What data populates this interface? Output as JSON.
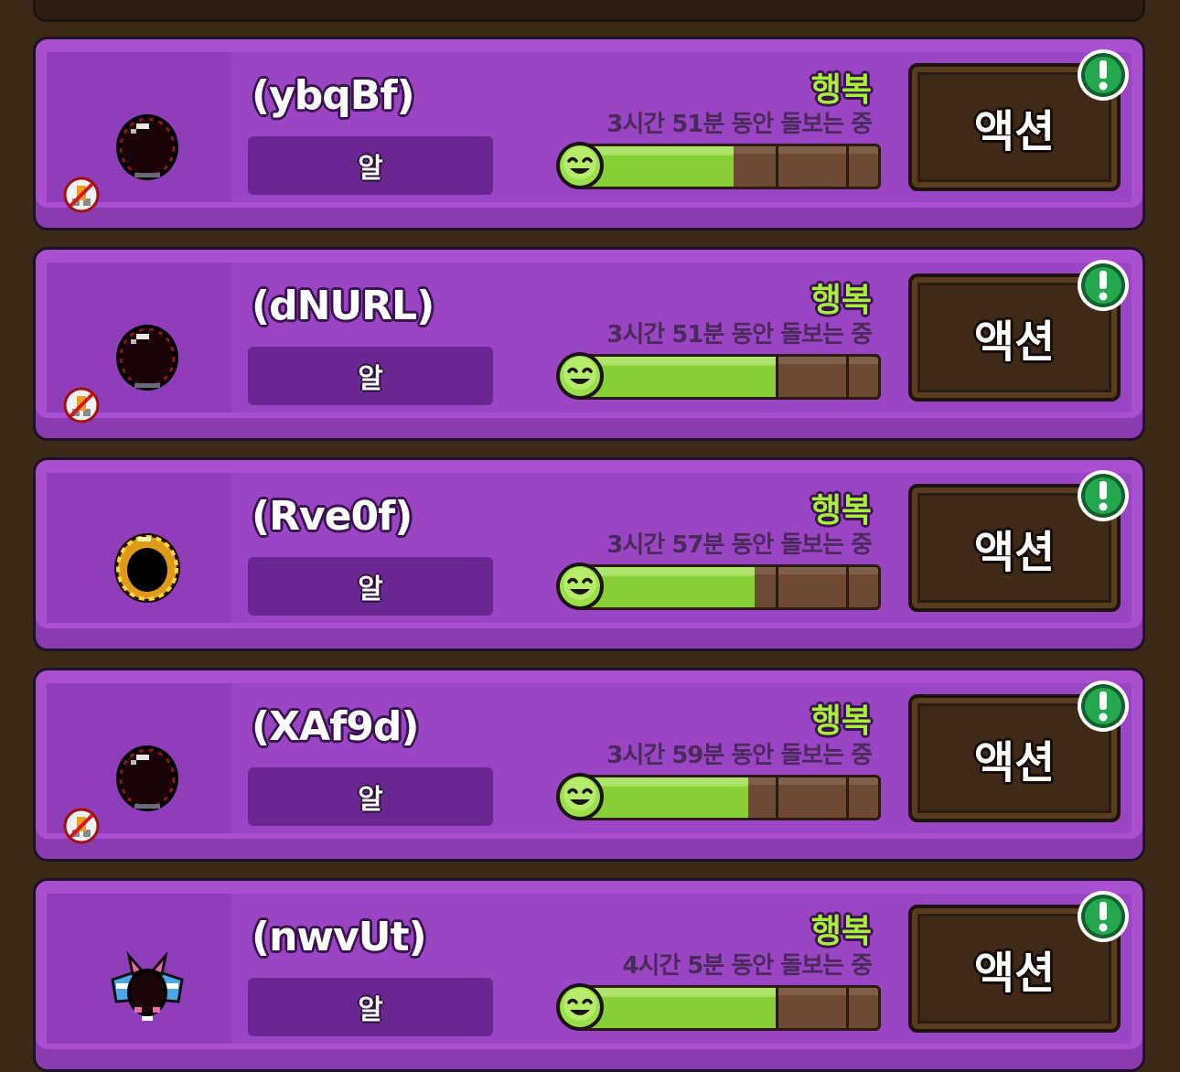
{
  "pets": [
    {
      "name": "(ybqBf)",
      "type": "알",
      "mood": "행복",
      "care_time": "3시간 51분 동안 돌보는 중",
      "happiness": 0.52,
      "sprite": "dark-egg",
      "badge": true
    },
    {
      "name": "(dNURL)",
      "type": "알",
      "mood": "행복",
      "care_time": "3시간 51분 동안 돌보는 중",
      "happiness": 0.67,
      "sprite": "dark-egg",
      "badge": true
    },
    {
      "name": "(Rve0f)",
      "type": "알",
      "mood": "행복",
      "care_time": "3시간 57분 동안 돌보는 중",
      "happiness": 0.59,
      "sprite": "gold-egg",
      "badge": false
    },
    {
      "name": "(XAf9d)",
      "type": "알",
      "mood": "행복",
      "care_time": "3시간 59분 동안 돌보는 중",
      "happiness": 0.57,
      "sprite": "dark-egg",
      "badge": true
    },
    {
      "name": "(nwvUt)",
      "type": "알",
      "mood": "행복",
      "care_time": "4시간 5분 동안 돌보는 중",
      "happiness": 0.66,
      "sprite": "winged-egg",
      "badge": false
    }
  ],
  "action_label": "액션",
  "icons": {
    "alert": "exclamation-alert-icon",
    "smiley": "smiley-face-icon",
    "badge": "no-evolution-badge-icon"
  },
  "colors": {
    "card": "#a94fd0",
    "panel": "#8f3db8",
    "type_box": "#6a2792",
    "mood_text": "#a6f03c",
    "bar_fill": "#86cf37",
    "bar_empty": "#6e4a33",
    "action_button": "#3e2a17",
    "alert_badge": "#1f9a47",
    "background": "#3c2a18"
  }
}
